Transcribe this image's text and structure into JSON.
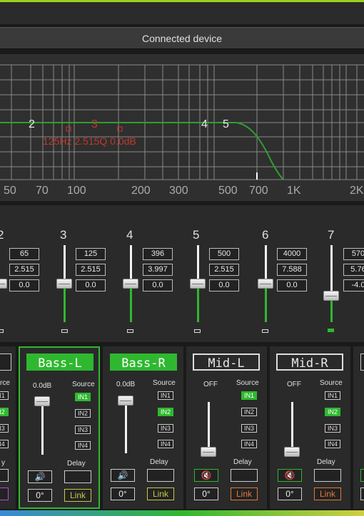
{
  "header": {
    "device_label": "Connected device"
  },
  "graph": {
    "freq_ticks": [
      "50",
      "70",
      "100",
      "200",
      "300",
      "500",
      "700",
      "1K",
      "2K"
    ],
    "point_labels": [
      "2",
      "3",
      "4",
      "5"
    ],
    "annotation": "125Hz 2.515Q 0.0dB"
  },
  "eq": {
    "bands": [
      {
        "num": "2",
        "freq": "65",
        "q": "2.515",
        "gain": "0.0"
      },
      {
        "num": "3",
        "freq": "125",
        "q": "2.515",
        "gain": "0.0"
      },
      {
        "num": "4",
        "freq": "396",
        "q": "3.997",
        "gain": "0.0"
      },
      {
        "num": "5",
        "freq": "500",
        "q": "2.515",
        "gain": "0.0"
      },
      {
        "num": "6",
        "freq": "4000",
        "q": "7.588",
        "gain": "0.0"
      },
      {
        "num": "7",
        "freq": "570",
        "q": "5.76",
        "gain": "-4.0"
      }
    ]
  },
  "channels": {
    "source_label": "Source",
    "delay_label": "Delay",
    "phase_value": "0°",
    "link_label": "Link",
    "inputs": [
      "IN1",
      "IN2",
      "IN3",
      "IN4"
    ],
    "list": [
      {
        "name": "Bass-L",
        "level": "0.0dB",
        "active_input": "IN1"
      },
      {
        "name": "Bass-R",
        "level": "0.0dB",
        "active_input": "IN2"
      },
      {
        "name": "Mid-L",
        "level": "OFF",
        "active_input": "IN1"
      },
      {
        "name": "Mid-R",
        "level": "OFF",
        "active_input": "IN2"
      }
    ],
    "partial_left": {
      "source_frag": "rce",
      "inputs": [
        "N1",
        "N2",
        "N3",
        "N4"
      ],
      "delay_frag": "y"
    }
  },
  "colors": {
    "accent_green": "#2fb82f",
    "link_yellow": "#c8c84a",
    "link_orange": "#e07a3a"
  }
}
